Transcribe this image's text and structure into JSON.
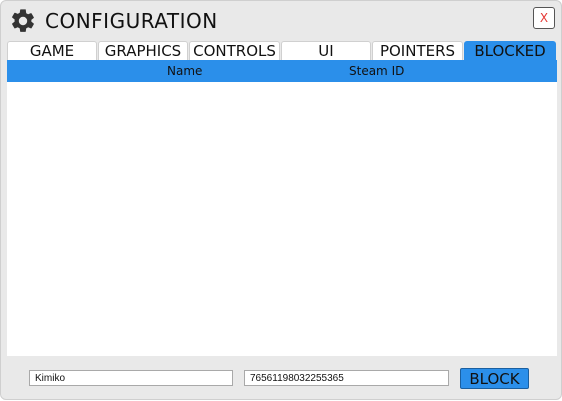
{
  "window": {
    "title": "CONFIGURATION",
    "close_label": "X"
  },
  "tabs": [
    {
      "label": "GAME",
      "active": false
    },
    {
      "label": "GRAPHICS",
      "active": false
    },
    {
      "label": "CONTROLS",
      "active": false
    },
    {
      "label": "UI",
      "active": false
    },
    {
      "label": "POINTERS",
      "active": false
    },
    {
      "label": "BLOCKED",
      "active": true
    }
  ],
  "table": {
    "columns": [
      "Name",
      "Steam ID"
    ],
    "rows": []
  },
  "form": {
    "name_value": "Kimiko",
    "steam_id_value": "76561198032255365",
    "block_label": "BLOCK"
  },
  "colors": {
    "accent": "#2b8fea",
    "close_x": "#e53935"
  }
}
